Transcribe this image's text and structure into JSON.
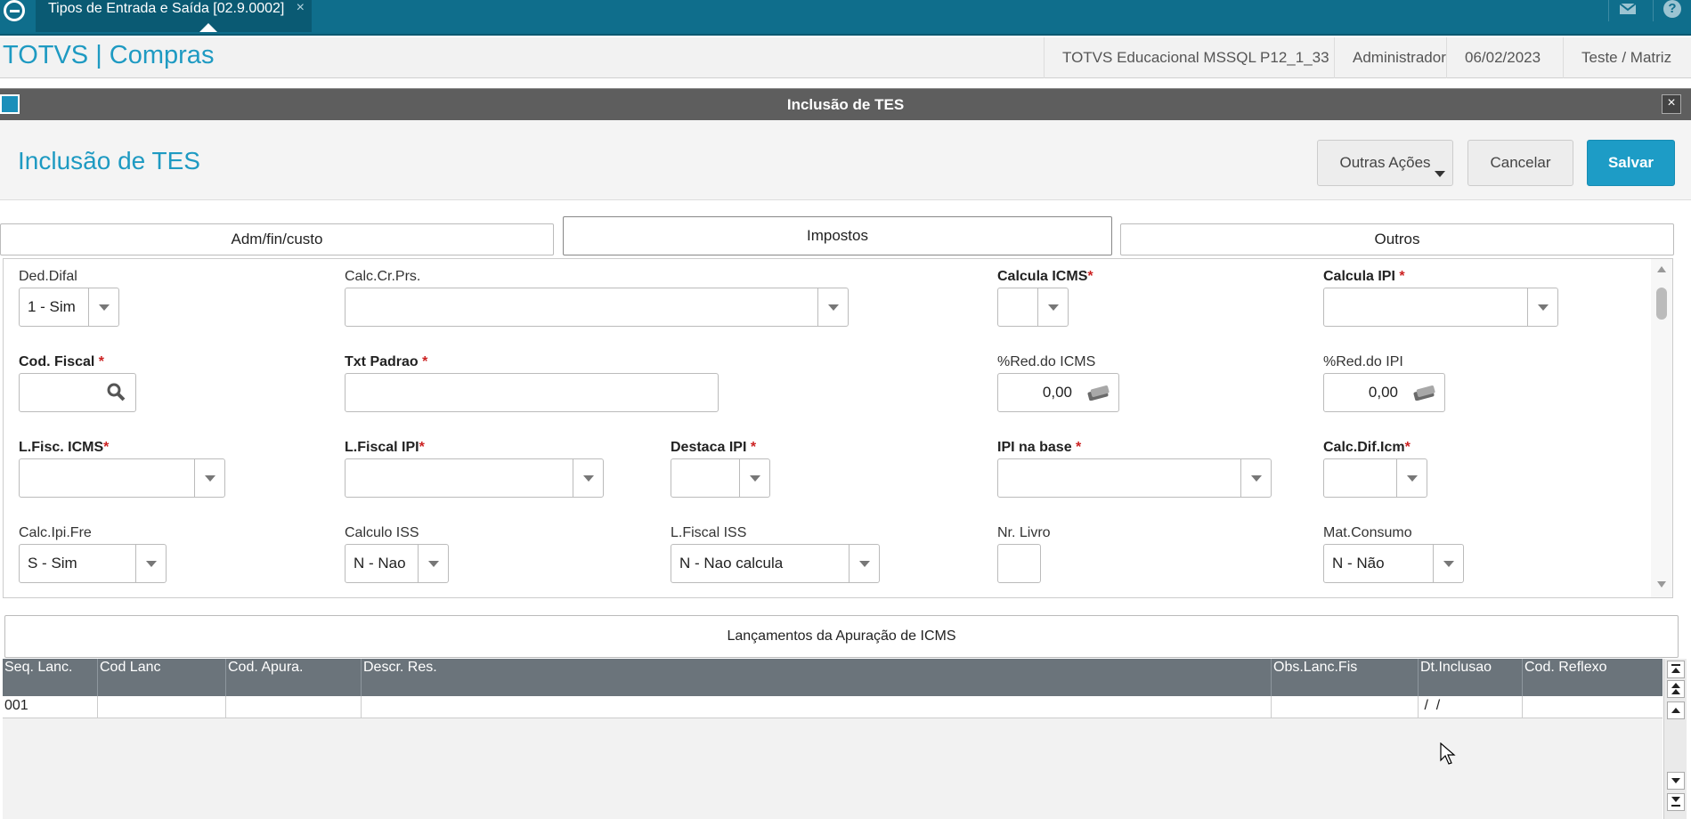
{
  "topbar": {
    "tab_label": "Tipos de Entrada e Saída [02.9.0002]",
    "tab_close": "×",
    "logo_icon": "totvs-logo-icon",
    "mail_icon": "mail-icon",
    "help_icon": "help-icon",
    "help_glyph": "?"
  },
  "header": {
    "app_title": "TOTVS | Compras",
    "environment": "TOTVS Educacional MSSQL P12_1_33",
    "user": "Administrador",
    "date": "06/02/2023",
    "branch": "Teste / Matriz"
  },
  "dialog": {
    "title": "Inclusão de TES",
    "close_glyph": "×"
  },
  "form": {
    "title": "Inclusão de TES",
    "buttons": {
      "more": "Outras Ações",
      "cancel": "Cancelar",
      "save": "Salvar"
    },
    "tabs": [
      {
        "label": "Adm/fin/custo",
        "active": false
      },
      {
        "label": "Impostos",
        "active": true
      },
      {
        "label": "Outros",
        "active": false
      }
    ],
    "fields": {
      "ded_difal": {
        "label": "Ded.Difal",
        "value": "1 - Sim"
      },
      "calc_cr_prs": {
        "label": "Calc.Cr.Prs.",
        "value": ""
      },
      "calcula_icms": {
        "label": "Calcula ICMS",
        "required": "*",
        "value": ""
      },
      "calcula_ipi": {
        "label": "Calcula IPI ",
        "required": "*",
        "value": ""
      },
      "cod_fiscal": {
        "label": "Cod. Fiscal ",
        "required": "*",
        "value": ""
      },
      "txt_padrao": {
        "label": "Txt Padrao ",
        "required": "*",
        "value": ""
      },
      "red_icms": {
        "label": "%Red.do ICMS",
        "value": "0,00"
      },
      "red_ipi": {
        "label": "%Red.do IPI",
        "value": "0,00"
      },
      "lfisc_icms": {
        "label": "L.Fisc. ICMS",
        "required": "*",
        "value": ""
      },
      "lfiscal_ipi": {
        "label": "L.Fiscal IPI",
        "required": "*",
        "value": ""
      },
      "destaca_ipi": {
        "label": "Destaca IPI ",
        "required": "*",
        "value": ""
      },
      "ipi_na_base": {
        "label": "IPI na base ",
        "required": "*",
        "value": ""
      },
      "calc_dif_icm": {
        "label": "Calc.Dif.Icm",
        "required": "*",
        "value": ""
      },
      "calc_ipi_fre": {
        "label": "Calc.Ipi.Fre",
        "value": "S - Sim"
      },
      "calculo_iss": {
        "label": "Calculo ISS",
        "value": "N - Nao"
      },
      "lfiscal_iss": {
        "label": "L.Fiscal ISS",
        "value": "N - Nao calcula"
      },
      "nr_livro": {
        "label": "Nr. Livro",
        "value": ""
      },
      "mat_consumo": {
        "label": "Mat.Consumo",
        "value": "N - Não"
      }
    }
  },
  "grid": {
    "title": "Lançamentos da Apuração de ICMS",
    "columns": [
      "Seq. Lanc.",
      "Cod Lanc",
      "Cod. Apura.",
      "Descr. Res.",
      "Obs.Lanc.Fis",
      "Dt.Inclusao",
      "Cod. Reflexo"
    ],
    "rows": [
      [
        "001",
        "",
        "",
        "",
        "",
        " /  /",
        ""
      ]
    ]
  }
}
